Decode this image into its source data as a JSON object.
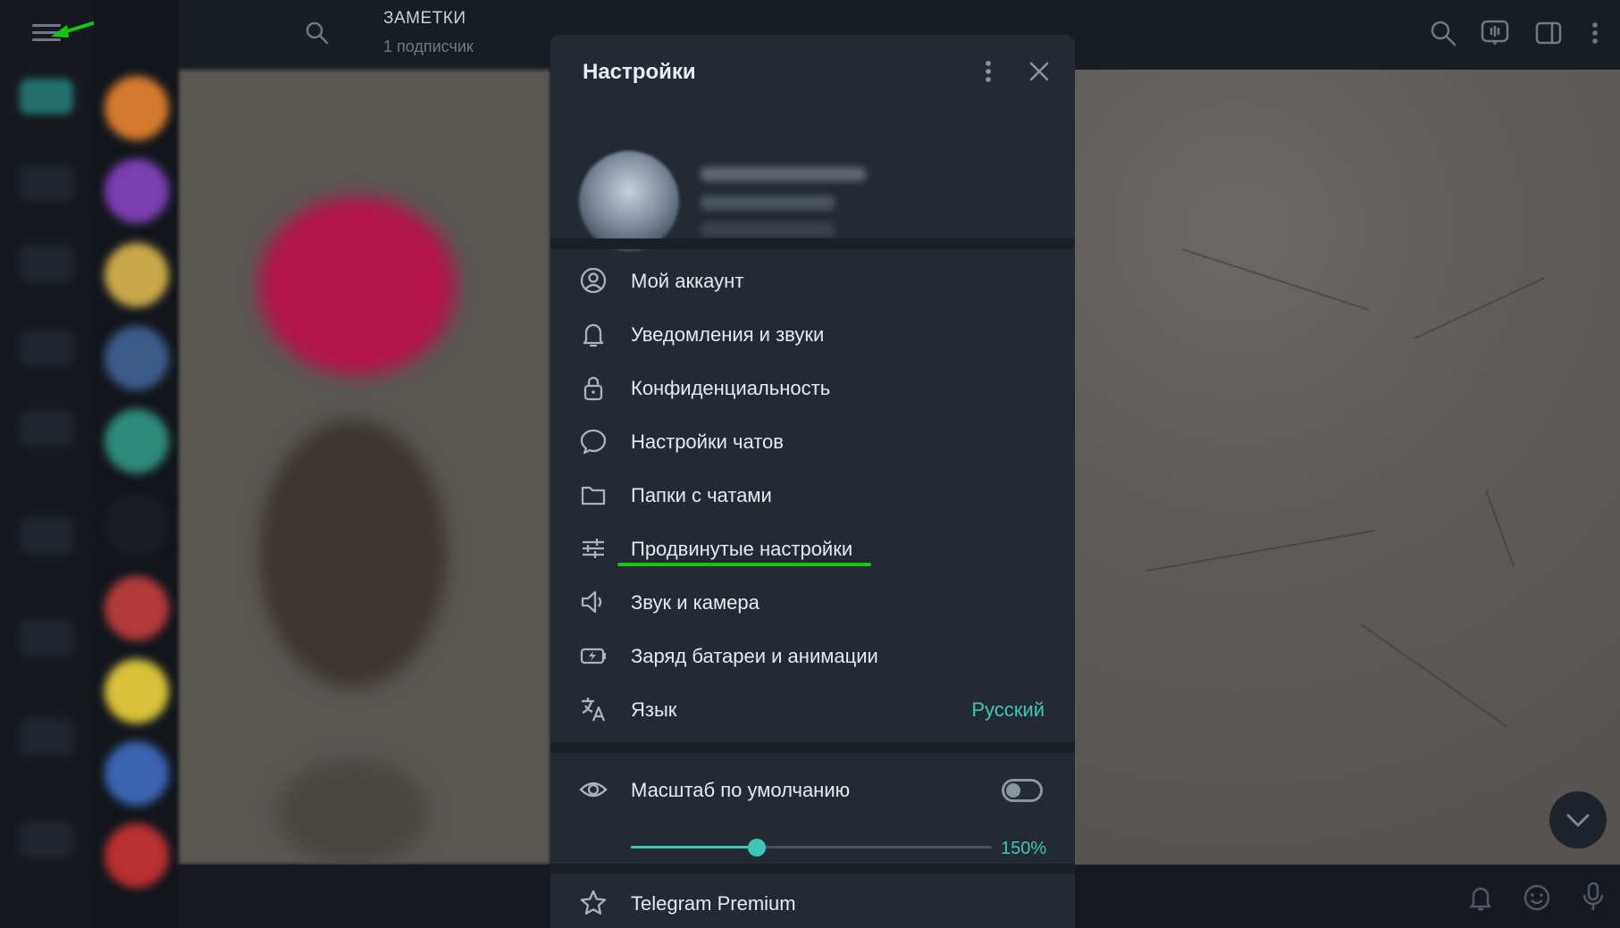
{
  "chat_header": {
    "title": "ЗАМЕТКИ",
    "subtitle": "1 подписчик"
  },
  "settings": {
    "title": "Настройки",
    "menu": [
      {
        "label": "Мой аккаунт",
        "icon": "account-icon"
      },
      {
        "label": "Уведомления и звуки",
        "icon": "bell-icon"
      },
      {
        "label": "Конфиденциальность",
        "icon": "lock-icon"
      },
      {
        "label": "Настройки чатов",
        "icon": "chat-bubble-icon"
      },
      {
        "label": "Папки с чатами",
        "icon": "folder-icon"
      },
      {
        "label": "Продвинутые настройки",
        "icon": "sliders-icon"
      },
      {
        "label": "Звук и камера",
        "icon": "speaker-icon"
      },
      {
        "label": "Заряд батареи и анимации",
        "icon": "battery-icon"
      },
      {
        "label": "Язык",
        "icon": "translate-icon",
        "value": "Русский"
      }
    ],
    "scale": {
      "label": "Масштаб по умолчанию",
      "toggle_on": false,
      "value_text": "150%",
      "slider_fraction": 0.35
    },
    "premium_label": "Telegram Premium"
  },
  "colors": {
    "accent": "#3fc6b4",
    "annotation": "#16c60c",
    "modal_bg": "#242a33"
  }
}
